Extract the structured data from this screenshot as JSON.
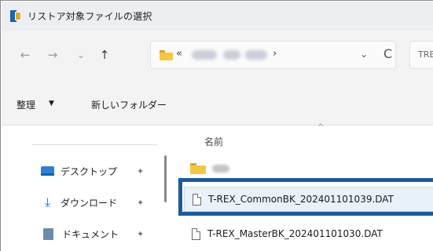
{
  "window": {
    "title": "リストア対象ファイルの選択"
  },
  "navigation": {
    "back_icon": "←",
    "forward_icon": "→",
    "recent_icon": "⌄",
    "up_icon": "↑",
    "address": {
      "separator_start": "«",
      "separator_end": "›",
      "dropdown_icon": "⌄",
      "refresh_icon": "C"
    },
    "search_text": "TRE"
  },
  "commands": {
    "organize": "整理",
    "organize_caret": "▼",
    "new_folder": "新しいフォルダー"
  },
  "sidebar": {
    "items": [
      {
        "label": "デスクトップ",
        "icon": "desktop-icon",
        "pin": "✦"
      },
      {
        "label": "ダウンロード",
        "icon": "download-icon",
        "pin": "✦"
      },
      {
        "label": "ドキュメント",
        "icon": "document-icon",
        "pin": "✦"
      }
    ],
    "download_glyph": "⤓"
  },
  "file_list": {
    "sort_indicator": "^",
    "column_name": "名前",
    "files": [
      {
        "name": "T-REX_CommonBK_202401101039.DAT",
        "selected": true
      },
      {
        "name": "T-REX_MasterBK_202401101030.DAT",
        "selected": false
      }
    ]
  },
  "colors": {
    "highlight_border": "#1e5a9c",
    "selected_row": "#e9f1fb"
  }
}
